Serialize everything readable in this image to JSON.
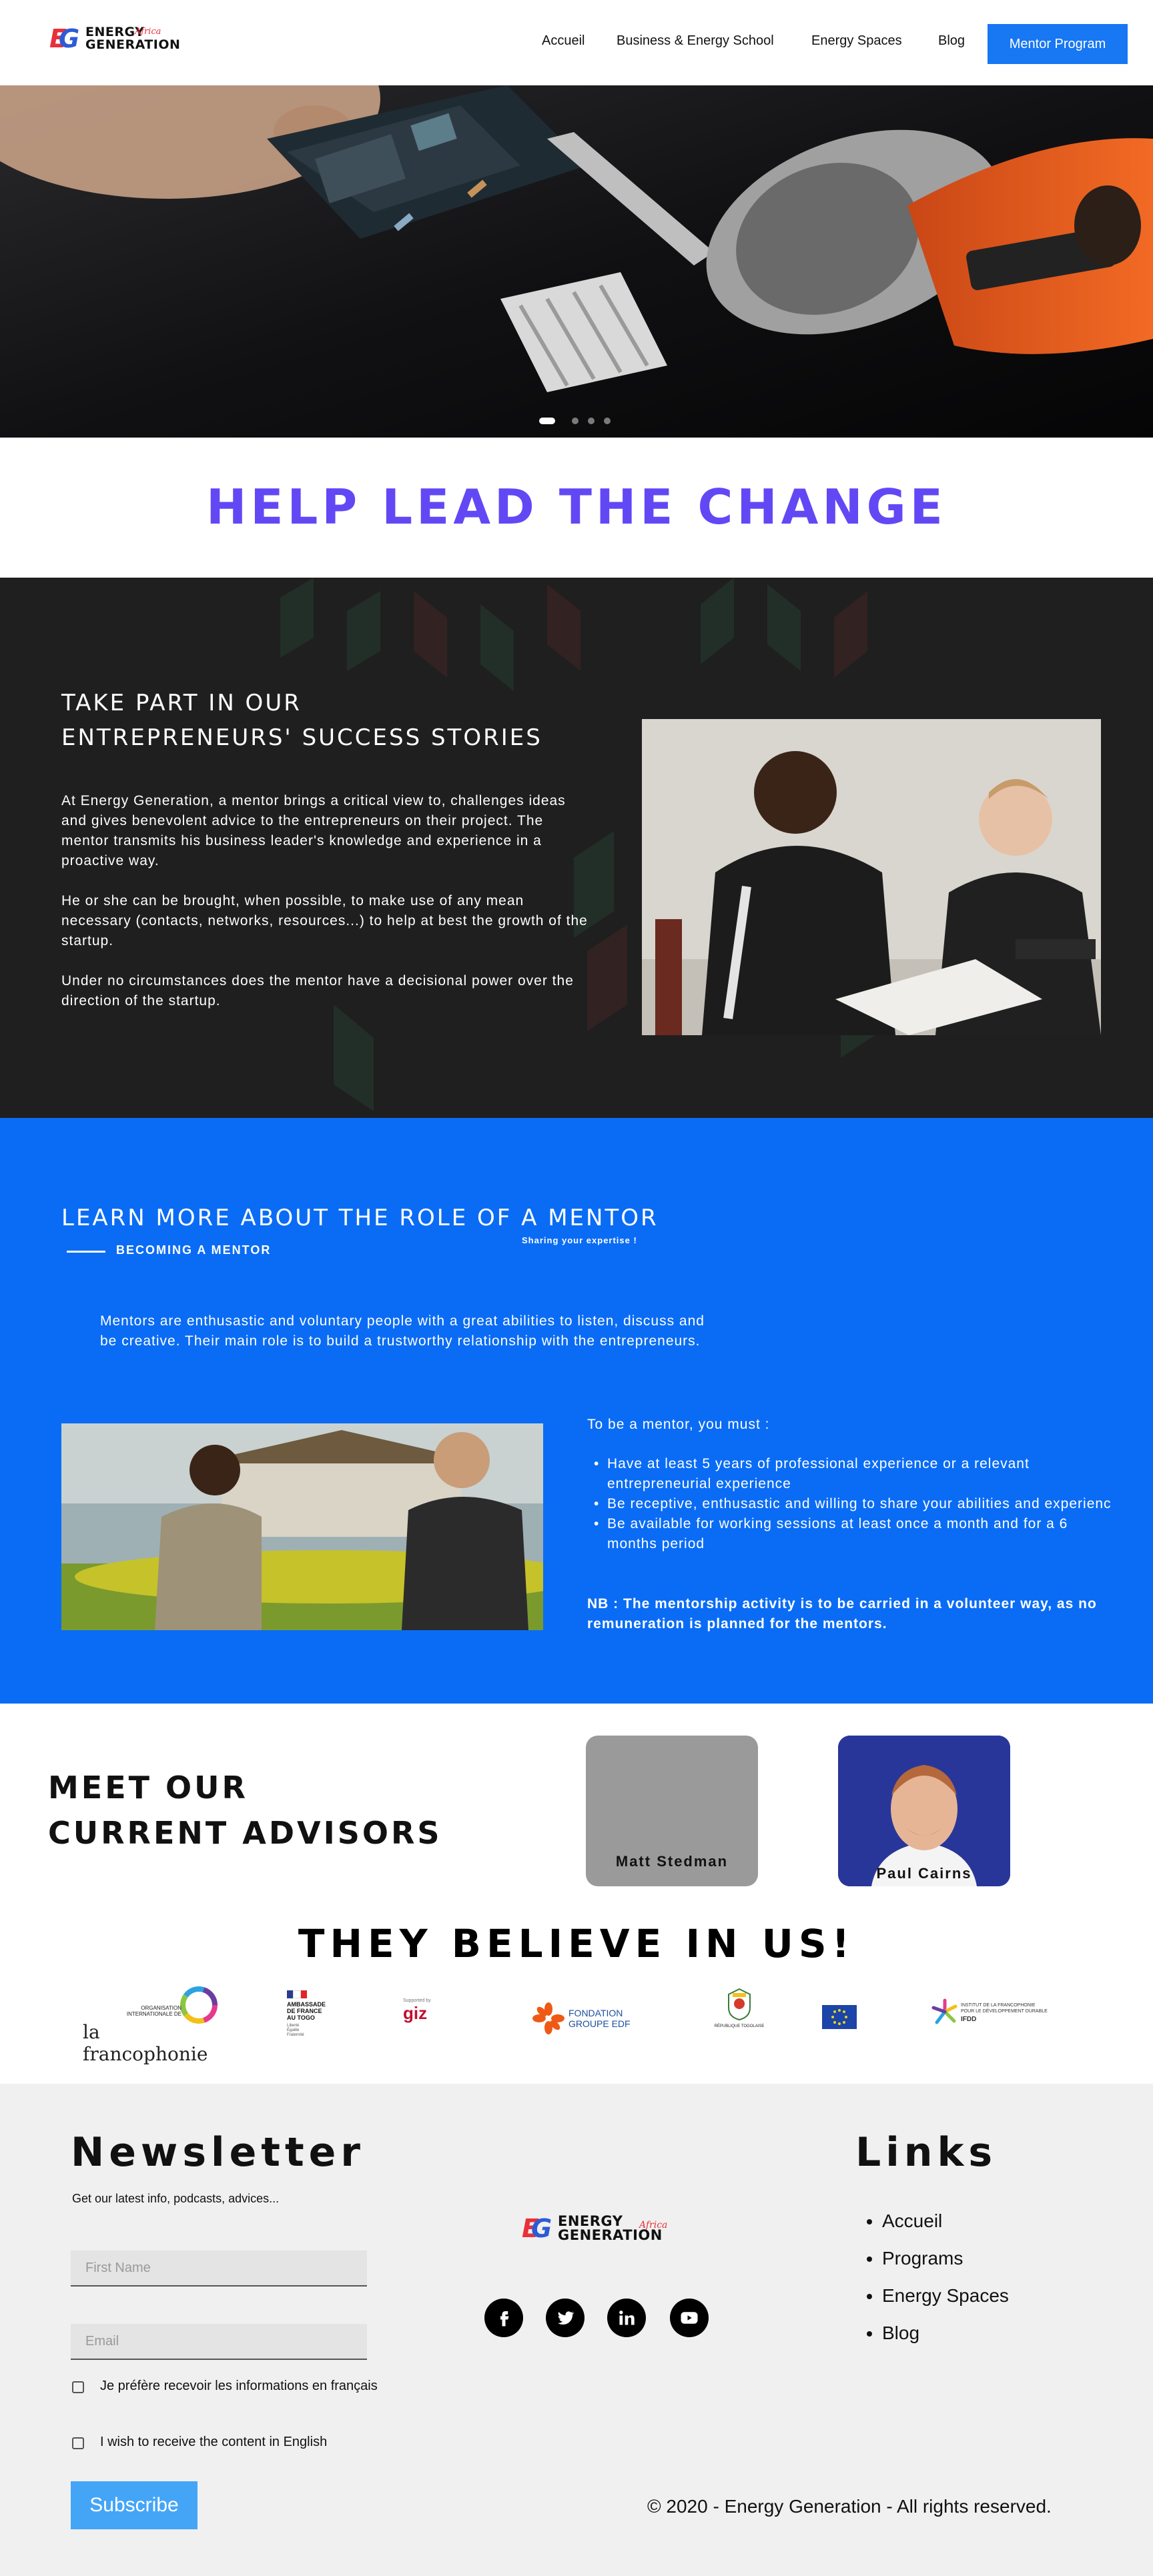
{
  "header": {
    "logo": {
      "line1": "ENERGY",
      "line2": "GENERATION",
      "tagline": "Africa"
    },
    "nav": [
      "Accueil",
      "Business & Energy School",
      "Energy Spaces",
      "Blog"
    ],
    "cta": "Mentor Program"
  },
  "hero": {
    "slides": 4,
    "active_slide": 1
  },
  "title_band": {
    "title": "HELP LEAD THE CHANGE"
  },
  "stories": {
    "title_line1": "TAKE PART IN OUR",
    "title_line2": "ENTREPRENEURS' SUCCESS STORIES",
    "p1": "At Energy Generation, a mentor brings a critical view to, challenges ideas and gives benevolent advice to the entrepreneurs on their project. The mentor transmits his business leader's knowledge and experience in a proactive way.",
    "p2": "He or she can be brought, when possible, to make use of any mean necessary (contacts, networks, resources...) to help at best the growth of the startup.",
    "p3": "Under no circumstances does the mentor have a decisional power over the direction of the startup."
  },
  "role": {
    "title": "LEARN MORE ABOUT THE ROLE OF A MENTOR",
    "subtitle": "BECOMING A MENTOR",
    "tagline": "Sharing your expertise !",
    "intro": "Mentors are enthusastic and voluntary people with a great abilities to listen, discuss and be creative. Their main role is to build a trustworthy relationship with the entrepreneurs.",
    "requirements_title": "To be a mentor, you must :",
    "requirements": [
      "Have at least 5 years of professional experience or a relevant entrepreneurial experience",
      "Be receptive, enthusastic and willing to share your abilities and experienc",
      "Be available for working sessions at least once a month and for a 6 months period"
    ],
    "nb": "NB : The mentorship activity is to be carried in a volunteer way, as no remuneration is planned for the mentors."
  },
  "advisors": {
    "title_line1": "MEET OUR",
    "title_line2": "CURRENT ADVISORS",
    "people": [
      "Matt Stedman",
      "Paul Cairns"
    ]
  },
  "partners": {
    "title": "THEY BELIEVE IN US!",
    "francophonie_small": "ORGANISATION\nINTERNATIONALE DE",
    "francophonie": "la francophonie",
    "ambassade": "AMBASSADE\nDE FRANCE\nAU TOGO",
    "ambassade_motto": "Liberté\nÉgalité\nFraternité",
    "giz_supported": "Supported by",
    "giz": "giz",
    "edf": "FONDATION\nGROUPE EDF",
    "togo": "RÉPUBLIQUE TOGOLAISE",
    "ifdd": "INSTITUT DE LA FRANCOPHONIE\nPOUR LE DÉVELOPPEMENT DURABLE",
    "ifdd_short": "IFDD"
  },
  "footer": {
    "newsletter_title": "Newsletter",
    "newsletter_sub": "Get our latest info, podcasts, advices...",
    "first_name_ph": "First Name",
    "email_ph": "Email",
    "opt_fr": "Je préfère recevoir les informations en français",
    "opt_en": "I wish to receive the content in English",
    "subscribe": "Subscribe",
    "links_title": "Links",
    "links": [
      "Accueil",
      "Programs",
      "Energy Spaces",
      "Blog"
    ],
    "copyright": "© 2020 - Energy Generation - All rights reserved."
  }
}
